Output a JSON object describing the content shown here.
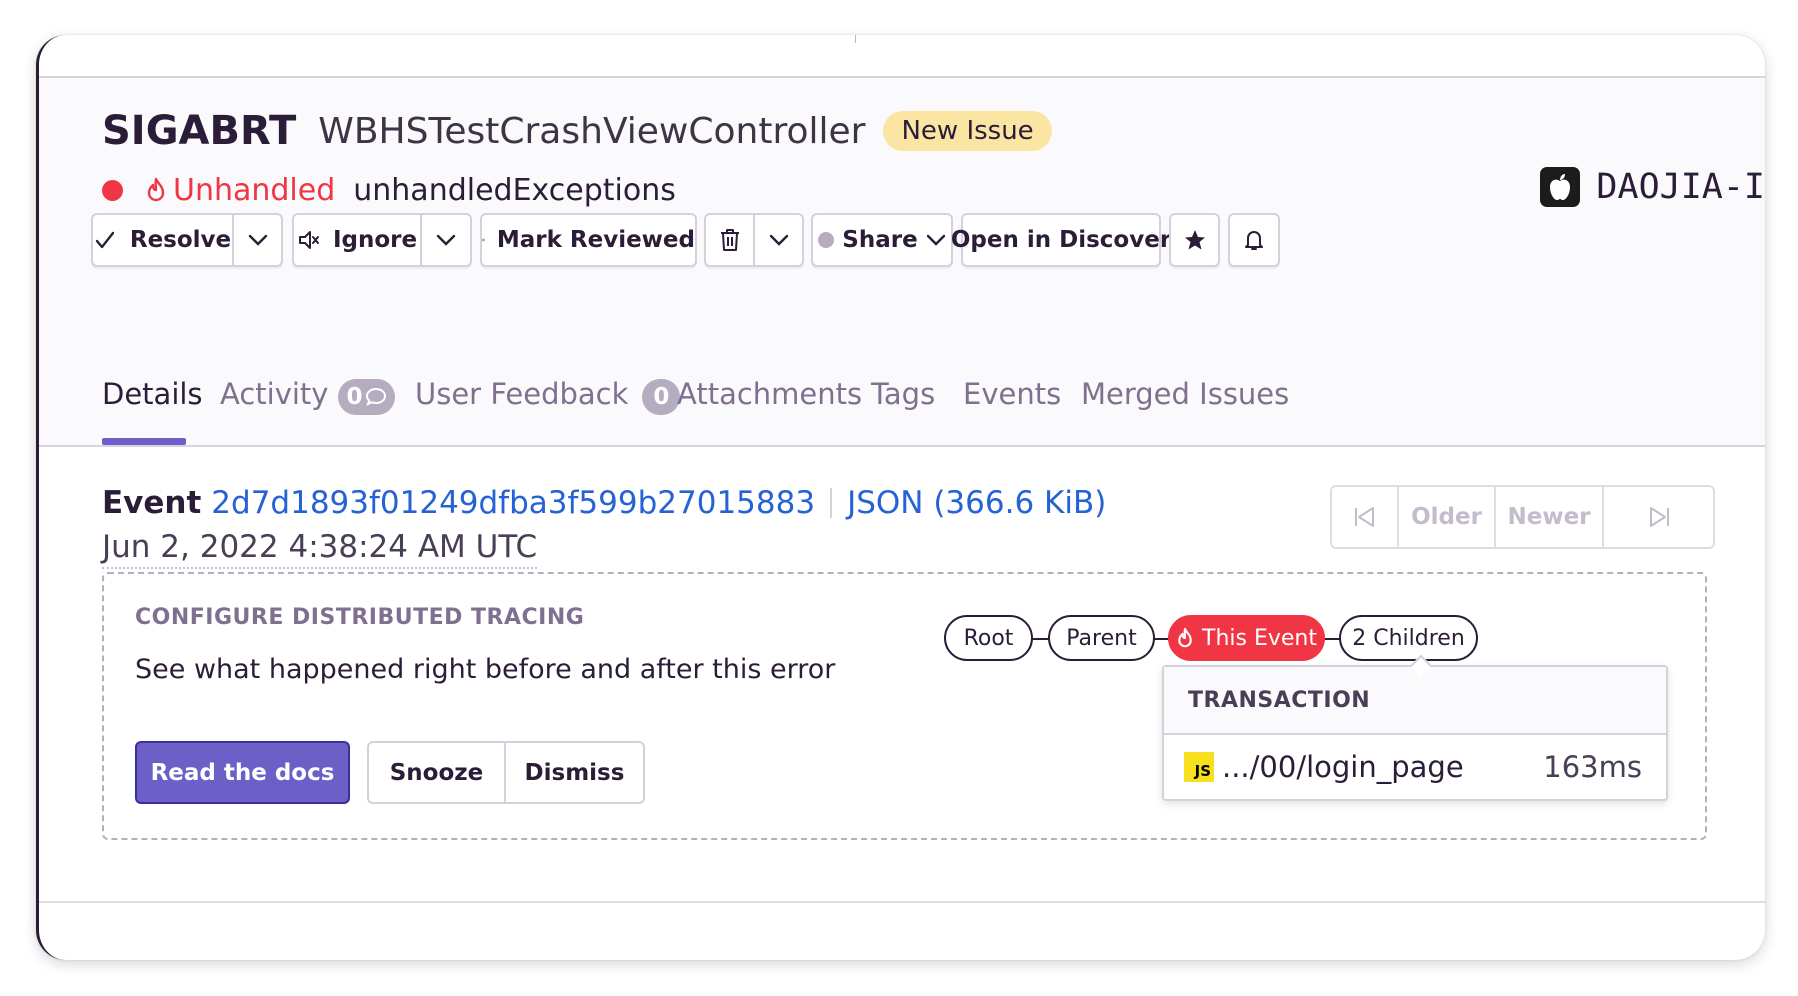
{
  "issue": {
    "type": "SIGABRT",
    "culprit": "WBHSTestCrashViewController",
    "badge": "New Issue",
    "unhandled_label": "Unhandled",
    "mechanism": "unhandledExceptions",
    "project": "DAOJIA-I"
  },
  "actions": {
    "resolve": "Resolve",
    "ignore": "Ignore",
    "mark_reviewed": "Mark Reviewed",
    "share": "Share",
    "open_in_discover": "Open in Discover"
  },
  "tabs": [
    {
      "label": "Details",
      "active": true
    },
    {
      "label": "Activity",
      "count": "0"
    },
    {
      "label": "User Feedback",
      "count": "0"
    },
    {
      "label": "Attachments"
    },
    {
      "label": "Tags"
    },
    {
      "label": "Events"
    },
    {
      "label": "Merged Issues"
    }
  ],
  "event": {
    "label": "Event",
    "id": "2d7d1893f01249dfba3f599b27015883",
    "json": "JSON (366.6 KiB)",
    "date": "Jun 2, 2022 4:38:24 AM UTC"
  },
  "pager": {
    "older": "Older",
    "newer": "Newer"
  },
  "tracing": {
    "title": "CONFIGURE DISTRIBUTED TRACING",
    "description": "See what happened right before and after this error",
    "read_docs": "Read the docs",
    "snooze": "Snooze",
    "dismiss": "Dismiss",
    "nodes": {
      "root": "Root",
      "parent": "Parent",
      "this_event": "This Event",
      "children": "2 Children"
    },
    "transaction": {
      "header": "TRANSACTION",
      "icon_label": "JS",
      "name": ".../00/login_page",
      "duration": "163ms"
    }
  },
  "colors": {
    "accent": "#6c5fc7",
    "error": "#f03645",
    "link": "#2562d4",
    "badge_new": "#fbe5a3"
  }
}
